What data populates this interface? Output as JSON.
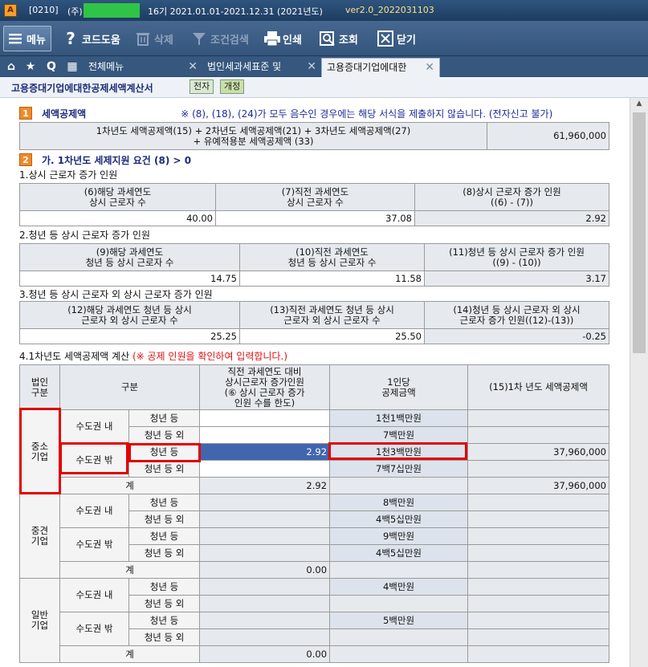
{
  "window": {
    "code": "[0210]",
    "company_prefix": "(주)",
    "period": "16기  2021.01.01-2021.12.31  (2021년도)",
    "version": "ver2.0_2022031103",
    "app_icon_letter": "A"
  },
  "toolbar": {
    "menu": "메뉴",
    "help": "코드도움",
    "delete": "삭제",
    "search": "조건검색",
    "print": "인쇄",
    "view": "조회",
    "close": "닫기"
  },
  "tabs": {
    "home_icon": "⌂",
    "star_icon": "★",
    "q_icon": "Q",
    "grid_icon": "▦",
    "items": [
      "전체메뉴",
      "법인세과세표준 및",
      "고용증대기업에대한"
    ],
    "close_glyph": "✕"
  },
  "doc": {
    "title": "고용증대기업에대한공제세액계산서",
    "chip_electronic": "전자",
    "chip_revision": "개정"
  },
  "section1": {
    "num": "1",
    "title": "세액공제액",
    "note": "※ (8), (18), (24)가 모두 음수인 경우에는 해당 서식을 제출하지 않습니다. (전자신고 불가)",
    "formula_line1": "1차년도 세액공제액(15) +  2차년도 세액공제액(21) + 3차년도 세액공제액(27)",
    "formula_line2": "+ 유예적용분 세액공제액 (33)",
    "value": "61,960,000"
  },
  "section2": {
    "num": "2",
    "title": "가. 1차년도 세제지원 요건 (8) > 0"
  },
  "sub1": {
    "label": "1.상시 근로자 증가 인원",
    "headers": [
      "(6)해당 과세연도\n상시 근로자 수",
      "(7)직전 과세연도\n상시 근로자 수",
      "(8)상시 근로자 증가 인원\n((6) - (7))"
    ],
    "values": [
      "40.00",
      "37.08",
      "2.92"
    ]
  },
  "sub2": {
    "label": "2.청년 등 상시 근로자 증가 인원",
    "headers": [
      "(9)해당 과세연도\n청년 등 상시 근로자 수",
      "(10)직전 과세연도\n청년 등 상시 근로자 수",
      "(11)청년 등 상시 근로자 증가 인원\n((9) - (10))"
    ],
    "values": [
      "14.75",
      "11.58",
      "3.17"
    ]
  },
  "sub3": {
    "label": "3.청년 등 상시 근로자 외 상시 근로자 증가 인원",
    "headers": [
      "(12)해당 과세연도 청년 등 상시\n근로자 외 상시 근로자 수",
      "(13)직전 과세연도 청년 등 상시\n근로자 외 상시 근로자 수",
      "(14)청년 등 상시 근로자 외 상시\n근로자 증가 인원((12)-(13))"
    ],
    "values": [
      "25.25",
      "25.50",
      "-0.25"
    ]
  },
  "sub4": {
    "label": "4.1차년도 세액공제액 계산",
    "note": "(※ 공제 인원을 확인하여 입력합니다.)",
    "col_headers": [
      "법인\n구분",
      "구분",
      "직전 과세연도 대비\n상시근로자 증가인원\n(⑥ 상시 근로자 증가\n인원 수를 한도)",
      "1인당\n공제금액",
      "(15)1차 년도 세액공제액"
    ],
    "region_in": "수도권 내",
    "region_out": "수도권 밖",
    "youth": "청년 등",
    "other": "청년 등 외",
    "total_label": "계",
    "groups": [
      {
        "name": "중소\n기업",
        "rows": [
          {
            "increase": "",
            "per": "1천1백만원",
            "credit": ""
          },
          {
            "increase": "",
            "per": "7백만원",
            "credit": ""
          },
          {
            "increase": "2.92",
            "per": "1천3백만원",
            "credit": "37,960,000"
          },
          {
            "increase": "",
            "per": "7백7십만원",
            "credit": ""
          }
        ],
        "total_increase": "2.92",
        "total_credit": "37,960,000"
      },
      {
        "name": "중견\n기업",
        "rows": [
          {
            "increase": "",
            "per": "8백만원",
            "credit": ""
          },
          {
            "increase": "",
            "per": "4백5십만원",
            "credit": ""
          },
          {
            "increase": "",
            "per": "9백만원",
            "credit": ""
          },
          {
            "increase": "",
            "per": "4백5십만원",
            "credit": ""
          }
        ],
        "total_increase": "0.00",
        "total_credit": ""
      },
      {
        "name": "일반\n기업",
        "rows": [
          {
            "increase": "",
            "per": "4백만원",
            "credit": ""
          },
          {
            "increase": "",
            "per": "",
            "credit": ""
          },
          {
            "increase": "",
            "per": "5백만원",
            "credit": ""
          },
          {
            "increase": "",
            "per": "",
            "credit": ""
          }
        ],
        "total_increase": "0.00",
        "total_credit": ""
      }
    ]
  },
  "colors": {
    "titlebar": "#1d3c60",
    "toolbar": "#3f6088",
    "section_num": "#ef8a2a",
    "highlight_box": "#e00000",
    "selected_cell": "#4166ae"
  }
}
